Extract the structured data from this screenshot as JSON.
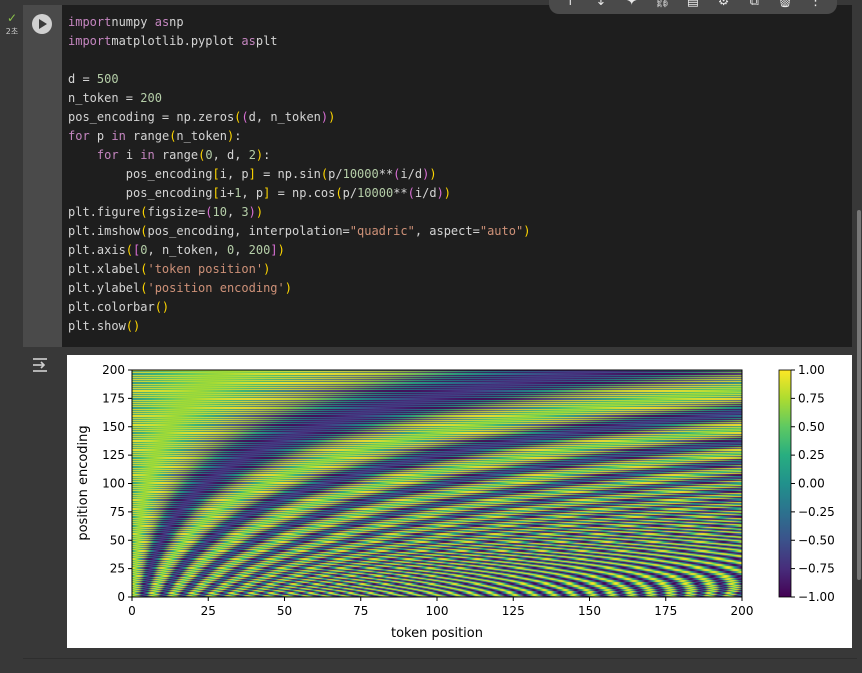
{
  "cell": {
    "status": {
      "check": "✓",
      "time": "2초"
    }
  },
  "toolbar": {
    "icons": [
      "arrow-up-icon",
      "arrow-down-icon",
      "sparkle-icon",
      "link-icon",
      "comment-icon",
      "gear-icon",
      "mirror-icon",
      "trash-icon",
      "more-icon"
    ],
    "glyphs": [
      "↑",
      "↓",
      "✦",
      "⛓",
      "▤",
      "⚙",
      "⧉",
      "🗑",
      "⋮"
    ]
  },
  "code": {
    "lines": [
      [
        [
          "kw",
          "import"
        ],
        [
          "",
          "numpy "
        ],
        [
          "kw",
          "as"
        ],
        [
          "",
          "np"
        ]
      ],
      [
        [
          "kw",
          "import"
        ],
        [
          "",
          "matplotlib.pyplot "
        ],
        [
          "kw",
          "as"
        ],
        [
          "",
          "plt"
        ]
      ],
      [],
      [
        [
          "",
          "d = "
        ],
        [
          "nm",
          "500"
        ]
      ],
      [
        [
          "",
          "n_token = "
        ],
        [
          "nm",
          "200"
        ]
      ],
      [
        [
          "",
          "pos_encoding = np.zeros"
        ],
        [
          "p1",
          "("
        ],
        [
          "p2",
          "("
        ],
        [
          "",
          "d, n_token"
        ],
        [
          "p2",
          ")"
        ],
        [
          "p1",
          ")"
        ]
      ],
      [
        [
          "kw",
          "for"
        ],
        [
          "",
          " p "
        ],
        [
          "kw",
          "in"
        ],
        [
          "",
          " range"
        ],
        [
          "p1",
          "("
        ],
        [
          "",
          "n_token"
        ],
        [
          "p1",
          ")"
        ],
        [
          "",
          ":"
        ]
      ],
      [
        [
          "",
          "    "
        ],
        [
          "kw",
          "for"
        ],
        [
          "",
          " i "
        ],
        [
          "kw",
          "in"
        ],
        [
          "",
          " range"
        ],
        [
          "p1",
          "("
        ],
        [
          "nm",
          "0"
        ],
        [
          "",
          ", d, "
        ],
        [
          "nm",
          "2"
        ],
        [
          "p1",
          ")"
        ],
        [
          "",
          ":"
        ]
      ],
      [
        [
          "",
          "        pos_encoding"
        ],
        [
          "p1",
          "["
        ],
        [
          "",
          "i, p"
        ],
        [
          "p1",
          "]"
        ],
        [
          "",
          " = np.sin"
        ],
        [
          "p1",
          "("
        ],
        [
          "",
          "p/"
        ],
        [
          "nm",
          "10000"
        ],
        [
          "",
          "**"
        ],
        [
          "p2",
          "("
        ],
        [
          "",
          "i/d"
        ],
        [
          "p2",
          ")"
        ],
        [
          "p1",
          ")"
        ]
      ],
      [
        [
          "",
          "        pos_encoding"
        ],
        [
          "p1",
          "["
        ],
        [
          "",
          "i+"
        ],
        [
          "nm",
          "1"
        ],
        [
          "",
          ", p"
        ],
        [
          "p1",
          "]"
        ],
        [
          "",
          " = np.cos"
        ],
        [
          "p1",
          "("
        ],
        [
          "",
          "p/"
        ],
        [
          "nm",
          "10000"
        ],
        [
          "",
          "**"
        ],
        [
          "p2",
          "("
        ],
        [
          "",
          "i/d"
        ],
        [
          "p2",
          ")"
        ],
        [
          "p1",
          ")"
        ]
      ],
      [
        [
          "",
          "plt.figure"
        ],
        [
          "p1",
          "("
        ],
        [
          "",
          "figsize="
        ],
        [
          "p2",
          "("
        ],
        [
          "nm",
          "10"
        ],
        [
          "",
          ", "
        ],
        [
          "nm",
          "3"
        ],
        [
          "p2",
          ")"
        ],
        [
          "p1",
          ")"
        ]
      ],
      [
        [
          "",
          "plt.imshow"
        ],
        [
          "p1",
          "("
        ],
        [
          "",
          "pos_encoding, interpolation="
        ],
        [
          "st",
          "\"quadric\""
        ],
        [
          "",
          ", aspect="
        ],
        [
          "st",
          "\"auto\""
        ],
        [
          "p1",
          ")"
        ]
      ],
      [
        [
          "",
          "plt.axis"
        ],
        [
          "p1",
          "("
        ],
        [
          "p2",
          "["
        ],
        [
          "nm",
          "0"
        ],
        [
          "",
          ", n_token, "
        ],
        [
          "nm",
          "0"
        ],
        [
          "",
          ", "
        ],
        [
          "nm",
          "200"
        ],
        [
          "p2",
          "]"
        ],
        [
          "p1",
          ")"
        ]
      ],
      [
        [
          "",
          "plt.xlabel"
        ],
        [
          "p1",
          "("
        ],
        [
          "st",
          "'token position'"
        ],
        [
          "p1",
          ")"
        ]
      ],
      [
        [
          "",
          "plt.ylabel"
        ],
        [
          "p1",
          "("
        ],
        [
          "st",
          "'position encoding'"
        ],
        [
          "p1",
          ")"
        ]
      ],
      [
        [
          "",
          "plt.colorbar"
        ],
        [
          "p1",
          "()"
        ]
      ],
      [
        [
          "",
          "plt.show"
        ],
        [
          "p1",
          "()"
        ]
      ]
    ]
  },
  "chart_data": {
    "type": "heatmap",
    "title": "",
    "xlabel": "token position",
    "ylabel": "position encoding",
    "xlim": [
      0,
      200
    ],
    "ylim": [
      0,
      200
    ],
    "xticks": [
      "0",
      "25",
      "50",
      "75",
      "100",
      "125",
      "150",
      "175",
      "200"
    ],
    "yticks": [
      "0",
      "25",
      "50",
      "75",
      "100",
      "125",
      "150",
      "175",
      "200"
    ],
    "colorbar": {
      "range": [
        -1.0,
        1.0
      ],
      "ticks": [
        "1.00",
        "0.75",
        "0.50",
        "0.25",
        "0.00",
        "−0.25",
        "−0.50",
        "−0.75",
        "−1.00"
      ]
    },
    "colormap": "viridis",
    "function": "sin/cos positional encoding, d=500, n_token=200"
  }
}
